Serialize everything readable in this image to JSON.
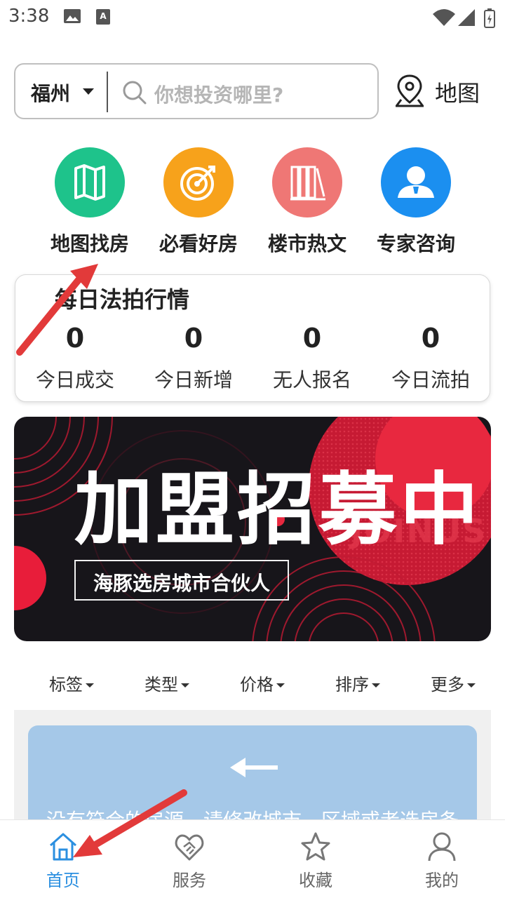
{
  "status_bar": {
    "time": "3:38"
  },
  "search": {
    "city": "福州",
    "placeholder": "你想投资哪里?",
    "map_label": "地图"
  },
  "quick_entries": [
    {
      "label": "地图找房",
      "icon": "map-icon",
      "color": "#1ec38b"
    },
    {
      "label": "必看好房",
      "icon": "target-icon",
      "color": "#f7a21b"
    },
    {
      "label": "楼市热文",
      "icon": "books-icon",
      "color": "#ef7775"
    },
    {
      "label": "专家咨询",
      "icon": "expert-icon",
      "color": "#1b8ff0"
    }
  ],
  "daily": {
    "title": "每日法拍行情",
    "stats": [
      {
        "value": "0",
        "label": "今日成交"
      },
      {
        "value": "0",
        "label": "今日新增"
      },
      {
        "value": "0",
        "label": "无人报名"
      },
      {
        "value": "0",
        "label": "今日流拍"
      }
    ]
  },
  "banner": {
    "title": "加盟招募中",
    "subtitle": "海豚选房城市合伙人",
    "english": "JOINUS"
  },
  "filters": [
    "标签",
    "类型",
    "价格",
    "排序",
    "更多"
  ],
  "empty_state": {
    "message": "没有符合的房源，请修改城市、区域或者选房条"
  },
  "tabs": [
    {
      "label": "首页",
      "icon": "home-icon",
      "active": true
    },
    {
      "label": "服务",
      "icon": "handshake-icon",
      "active": false
    },
    {
      "label": "收藏",
      "icon": "star-icon",
      "active": false
    },
    {
      "label": "我的",
      "icon": "user-icon",
      "active": false
    }
  ],
  "colors": {
    "accent": "#2b8fe0",
    "arrow": "#e23a3a"
  }
}
